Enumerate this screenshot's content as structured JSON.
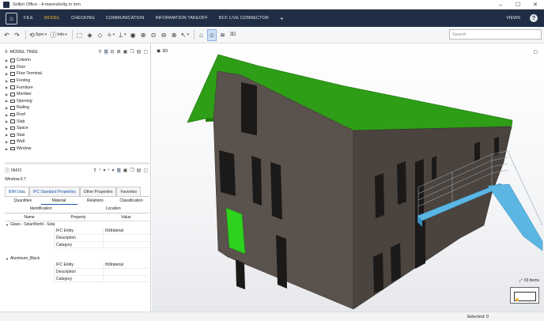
{
  "window": {
    "title": "Solibri Office - 4-mannsbolig m mm",
    "controls": [
      "–",
      "☐",
      "✕"
    ]
  },
  "menu": {
    "items": [
      "FILE",
      "MODEL",
      "CHECKING",
      "COMMUNICATION",
      "INFORMATION TAKEOFF",
      "BCF LIVE CONNECTOR"
    ],
    "active": "MODEL",
    "plus": "+",
    "views": "VIEWS",
    "help": "?"
  },
  "toolbar": {
    "spin_label": "Spin",
    "info_label": "Info",
    "search_placeholder": "Search"
  },
  "model_tree": {
    "title": "MODEL TREE",
    "items": [
      "Column",
      "Door",
      "Flow Terminal",
      "Footing",
      "Furniture",
      "Member",
      "Opening",
      "Railing",
      "Roof",
      "Slab",
      "Space",
      "Stair",
      "Wall",
      "Window"
    ]
  },
  "info": {
    "title": "INFO",
    "selected": "Window.0.7",
    "tabs": [
      "BIM Data",
      "IFC Standard Properties",
      "Other Properties",
      "Favorites"
    ],
    "subtabs": [
      "Quantities",
      "Material",
      "Relations",
      "Classification"
    ],
    "subtabs2": [
      "Identification",
      "Location"
    ],
    "columns": [
      "Name",
      "Property",
      "Value"
    ],
    "groups": [
      {
        "name": "Glass - SolarWorld - Sola",
        "rows": [
          {
            "prop": "IFC Entity",
            "value": "IfcMaterial"
          },
          {
            "prop": "Description",
            "value": ""
          },
          {
            "prop": "Category",
            "value": ""
          }
        ]
      },
      {
        "name": "Aluminum_Black",
        "rows": [
          {
            "prop": "IFC Entity",
            "value": "IfcMaterial"
          },
          {
            "prop": "Description",
            "value": ""
          },
          {
            "prop": "Category",
            "value": ""
          }
        ]
      }
    ]
  },
  "viewport": {
    "label": "3D",
    "items_count": "03 Items"
  },
  "status": {
    "selected": "Selected: 0"
  },
  "colors": {
    "menubar": "#1f2d45",
    "accent": "#f2b635",
    "roof": "#2e9e16",
    "wall": "#4d4641",
    "selected_door": "#2fd11f",
    "balcony": "#5bb6e3"
  }
}
